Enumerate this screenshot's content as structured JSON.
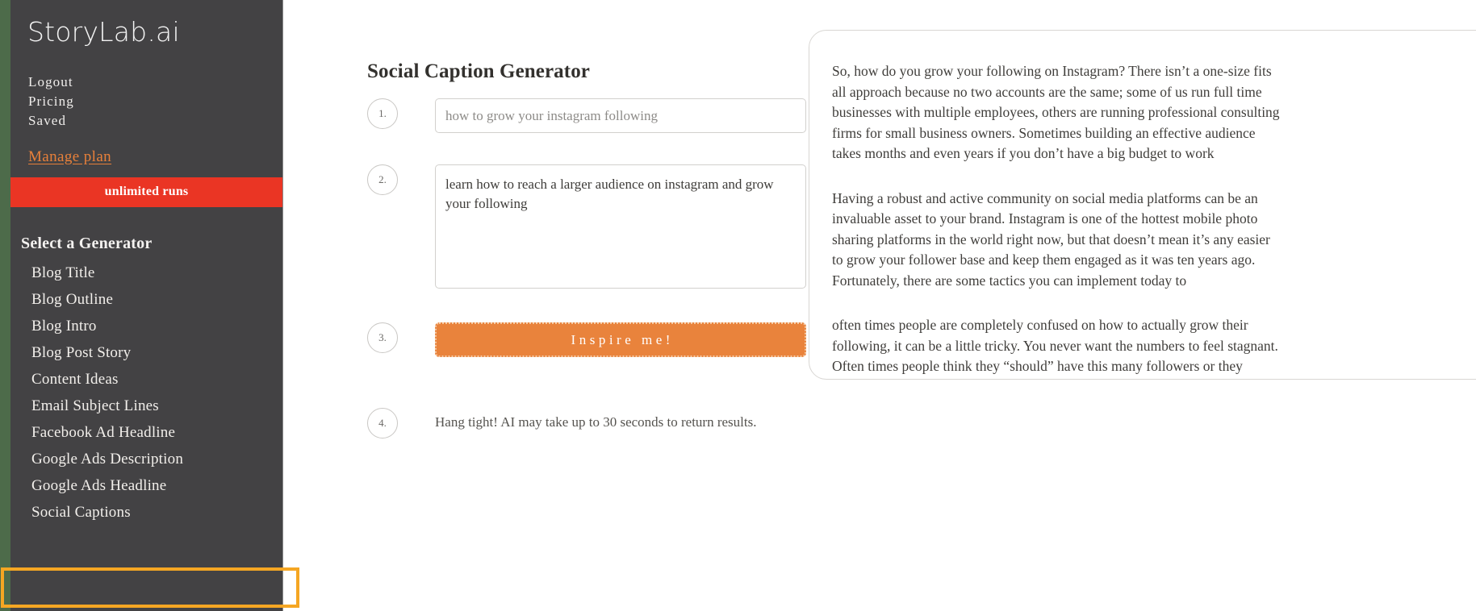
{
  "brand": {
    "logo": "StoryLab.ai",
    "colors": {
      "sidebar_bg": "#434244",
      "accent_orange": "#e9833c",
      "banner_red": "#ea3524",
      "highlight_amber": "#f5a623",
      "page_green": "#4d6b4a"
    }
  },
  "sidebar": {
    "nav": [
      {
        "label": "Logout"
      },
      {
        "label": "Pricing"
      },
      {
        "label": "Saved"
      }
    ],
    "manage_plan_label": "Manage plan",
    "runs_banner": "unlimited runs",
    "generators_heading": "Select a Generator",
    "generators": [
      {
        "label": "Blog Title",
        "selected": false
      },
      {
        "label": "Blog Outline",
        "selected": false
      },
      {
        "label": "Blog Intro",
        "selected": false
      },
      {
        "label": "Blog Post Story",
        "selected": false
      },
      {
        "label": "Content Ideas",
        "selected": false
      },
      {
        "label": "Email Subject Lines",
        "selected": false
      },
      {
        "label": "Facebook Ad Headline",
        "selected": false
      },
      {
        "label": "Google Ads Description",
        "selected": false
      },
      {
        "label": "Google Ads Headline",
        "selected": false
      },
      {
        "label": "Social Captions",
        "selected": true
      }
    ]
  },
  "main": {
    "title": "Social Caption Generator",
    "steps": {
      "one": "1.",
      "two": "2.",
      "three": "3.",
      "four": "4."
    },
    "topic_field": {
      "placeholder": "how to grow your instagram following",
      "value": ""
    },
    "description_field": {
      "placeholder": "",
      "value": "learn how to reach a larger audience on instagram and grow your following"
    },
    "inspire_button_label": "Inspire me!",
    "hint": "Hang tight! AI may take up to 30 seconds to return results."
  },
  "results": {
    "paragraphs": [
      " So, how do you grow your following on Instagram? There isn’t a one-size fits all approach because no two accounts are the same; some of us run full time businesses with multiple employees, others are running professional consulting firms for small business owners. Sometimes building an effective audience takes months and even years if you don’t have a big budget to work",
      " Having a robust and active community on social media platforms can be an invaluable asset to your brand. Instagram is one of the hottest mobile photo sharing platforms in the world right now, but that doesn’t mean it’s any easier to grow your follower base and keep them engaged as it was ten years ago. Fortunately, there are some tactics you can implement today to",
      " often times people are completely confused on how to actually grow their following, it can be a little tricky. You never want the numbers to feel stagnant. Often times people think they “should” have this many followers or they “need” some amount of engagement in order for them to reach out and engage with other brands who might want what they have."
    ]
  }
}
